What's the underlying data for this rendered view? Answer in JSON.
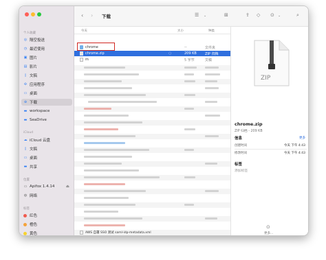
{
  "sidebar": {
    "favorites_header": "个人收藏",
    "favorites": [
      {
        "label": "隔空投送",
        "icon": "airdrop-icon"
      },
      {
        "label": "最近使用",
        "icon": "clock-icon"
      },
      {
        "label": "图片",
        "icon": "photo-icon"
      },
      {
        "label": "影片",
        "icon": "film-icon"
      },
      {
        "label": "文稿",
        "icon": "document-icon"
      },
      {
        "label": "应用程序",
        "icon": "apps-icon"
      },
      {
        "label": "桌面",
        "icon": "desktop-icon"
      },
      {
        "label": "下载",
        "icon": "download-icon"
      },
      {
        "label": "workspace",
        "icon": "folder-icon"
      },
      {
        "label": "SeaDrive",
        "icon": "folder-icon"
      }
    ],
    "icloud_header": "iCloud",
    "icloud": [
      {
        "label": "iCloud 云盘",
        "icon": "cloud-icon"
      },
      {
        "label": "文稿",
        "icon": "document-icon"
      },
      {
        "label": "桌面",
        "icon": "desktop-icon"
      },
      {
        "label": "共享",
        "icon": "shared-folder-icon"
      }
    ],
    "locations_header": "位置",
    "locations": [
      {
        "label": "Apifox 1.4.14",
        "icon": "disk-icon"
      },
      {
        "label": "网络",
        "icon": "globe-icon"
      }
    ],
    "tags_header": "标签",
    "tags": [
      {
        "label": "红色",
        "color": "#f05a4f"
      },
      {
        "label": "橙色",
        "color": "#f5a23a"
      },
      {
        "label": "黄色",
        "color": "#f6d32d"
      }
    ]
  },
  "toolbar": {
    "title": "下载"
  },
  "columns": {
    "name": "名称",
    "size": "大小",
    "kind": "种类"
  },
  "group_header": "今天",
  "rows": [
    {
      "name": "chrome",
      "size": "--",
      "kind": "文件夹",
      "state": "normal"
    },
    {
      "name": "chrome.zip",
      "size": "209 KB",
      "kind": "ZIP 归档",
      "state": "selected"
    },
    {
      "name": "m",
      "size": "5 字节",
      "kind": "文稿",
      "state": "normal"
    }
  ],
  "partial_bottom_row": "AWS 自署 SSO 测试 saml-idp-metadata.xml",
  "preview": {
    "file_type_badge": "ZIP",
    "filename": "chrome.zip",
    "subtitle": "ZIP 归档 - 209 KB",
    "info_header": "信息",
    "more_link": "更多",
    "created_label": "创建时间",
    "created_value": "今天 下午 4:43",
    "modified_label": "修改时间",
    "modified_value": "今天 下午 4:43",
    "tags_header": "标签",
    "tags_placeholder": "添加标签",
    "more_button": "更多..."
  }
}
